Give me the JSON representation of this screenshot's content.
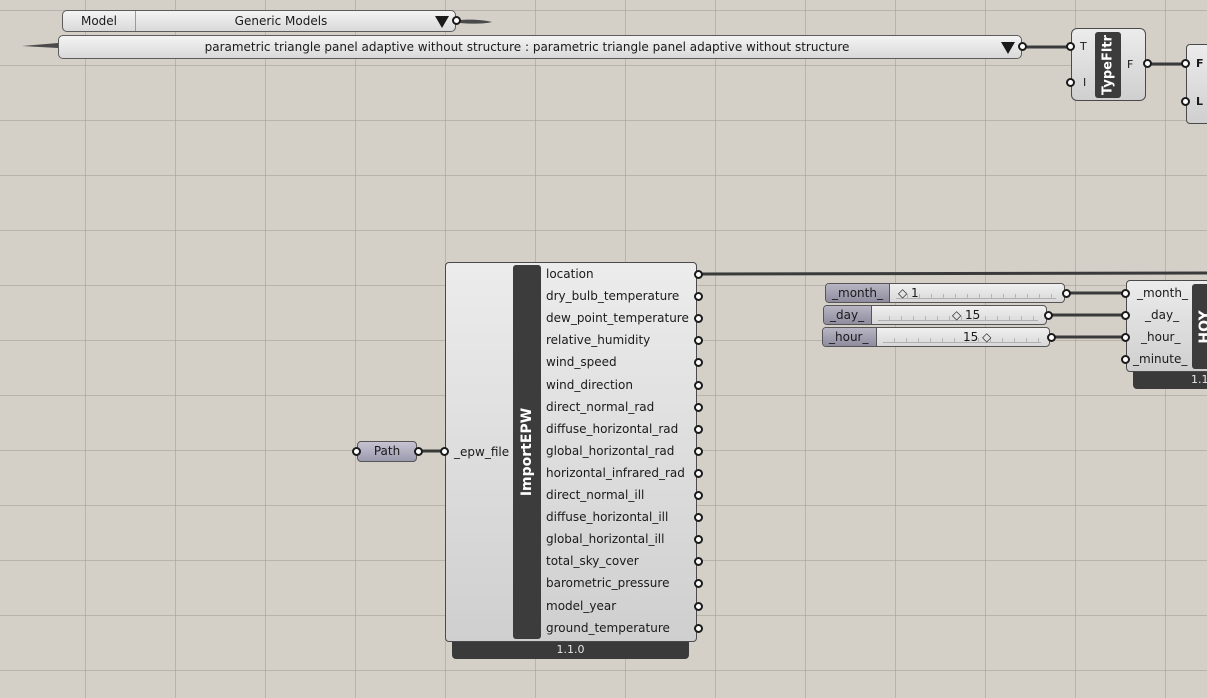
{
  "model_list": {
    "label": "Model",
    "value": "Generic Models"
  },
  "element_list": {
    "value": "parametric triangle panel adaptive without structure : parametric triangle panel adaptive without structure"
  },
  "type_filter": {
    "name": "TypeFltr",
    "inputs": [
      "T",
      "I"
    ],
    "output": "F"
  },
  "right_edge_component": {
    "inputs": [
      "F",
      "L"
    ]
  },
  "path_param": {
    "label": "Path"
  },
  "import_epw": {
    "name": "ImportEPW",
    "input": "_epw_file",
    "version": "1.1.0",
    "outputs": [
      "location",
      "dry_bulb_temperature",
      "dew_point_temperature",
      "relative_humidity",
      "wind_speed",
      "wind_direction",
      "direct_normal_rad",
      "diffuse_horizontal_rad",
      "global_horizontal_rad",
      "horizontal_infrared_rad",
      "direct_normal_ill",
      "diffuse_horizontal_ill",
      "global_horizontal_ill",
      "total_sky_cover",
      "barometric_pressure",
      "model_year",
      "ground_temperature"
    ]
  },
  "sliders": [
    {
      "label": "_month_",
      "value": "1"
    },
    {
      "label": "_day_",
      "value": "15"
    },
    {
      "label": "_hour_",
      "value": "15"
    }
  ],
  "hoy": {
    "name": "HOY",
    "inputs": [
      "_month_",
      "_day_",
      "_hour_",
      "_minute_"
    ],
    "version": "1.1"
  }
}
